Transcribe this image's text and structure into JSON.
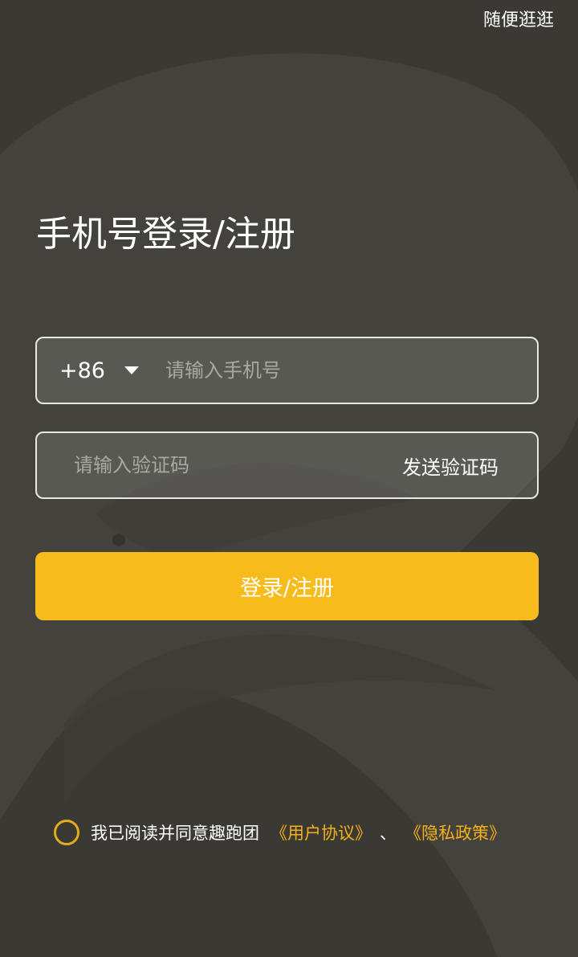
{
  "header": {
    "skip_label": "随便逛逛"
  },
  "title": "手机号登录/注册",
  "phone": {
    "country_code": "+86",
    "placeholder": "请输入手机号",
    "value": ""
  },
  "code": {
    "placeholder": "请输入验证码",
    "value": "",
    "send_label": "发送验证码"
  },
  "login_button_label": "登录/注册",
  "agreement": {
    "prefix": "我已阅读并同意趣跑团",
    "user_agreement": "《用户协议》",
    "separator": "、",
    "privacy_policy": "《隐私政策》",
    "checked": false
  },
  "colors": {
    "background": "#3a3933",
    "accent": "#f7bb1c",
    "link": "#f4b21a",
    "placeholder": "#a9a8a2"
  }
}
